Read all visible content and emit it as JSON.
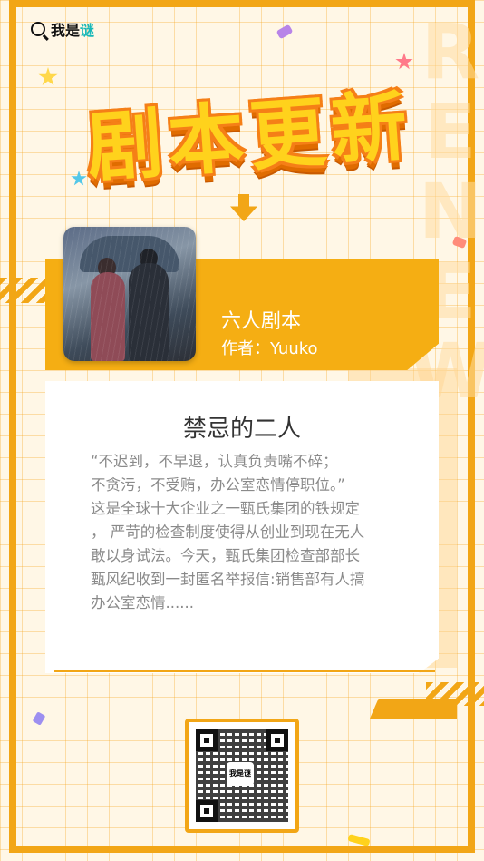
{
  "brand": {
    "logo_part1": "我是",
    "logo_part2": "谜"
  },
  "headline": "剧本更新",
  "background_word": "RENEW",
  "script": {
    "type": "六人剧本",
    "author": "作者：Yuuko"
  },
  "card": {
    "title": "禁忌的二人",
    "body": "“不迟到，不早退，认真负责嘴不碎；\n不贪污，不受贿，办公室恋情停职位。”\n这是全球十大企业之一甄氏集团的铁规定\n， 严苛的检查制度使得从创业到现在无人\n敢以身试法。今天，甄氏集团检查部部长\n甄风纪收到一封匿名举报信:销售部有人搞\n办公室恋情......"
  },
  "qr": {
    "center_label": "我是谜"
  },
  "colors": {
    "accent": "#f2a616",
    "title_fill": "#ffd21c",
    "background": "#fff7e6"
  }
}
